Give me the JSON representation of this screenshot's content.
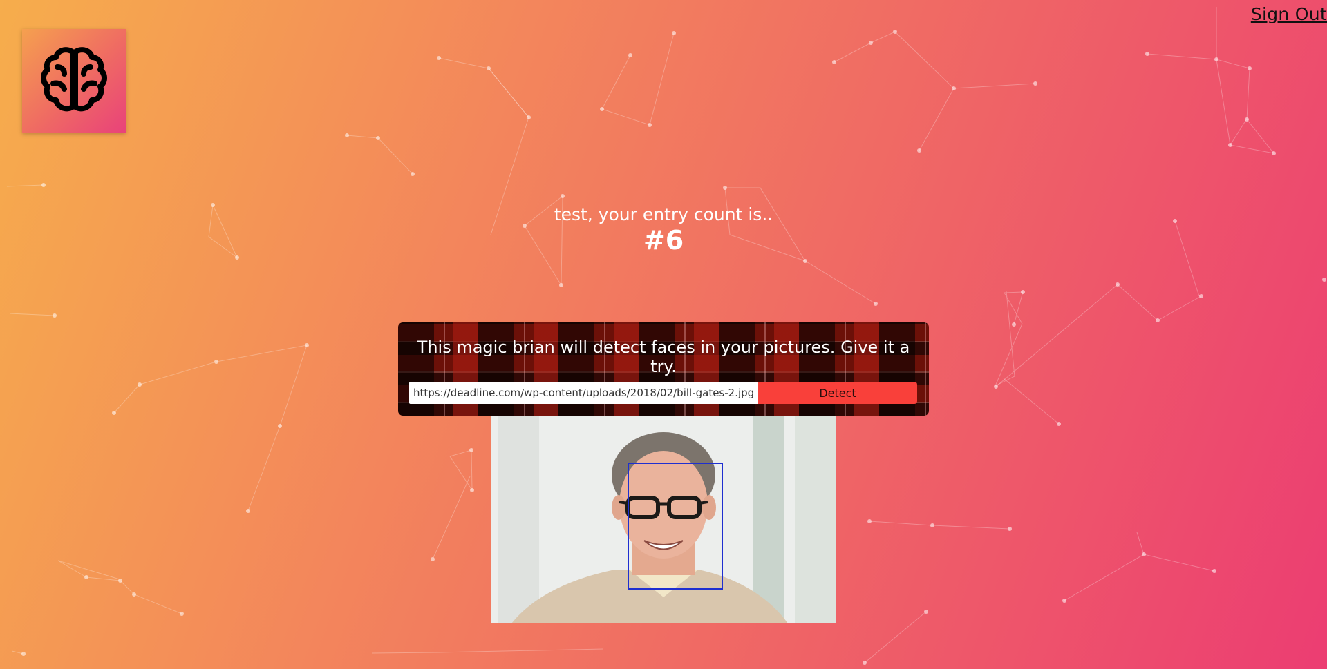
{
  "header": {
    "sign_out_label": "Sign Out",
    "logo_icon": "brain-icon"
  },
  "welcome": {
    "greeting": "test, your entry count is..",
    "count": "#6"
  },
  "detector": {
    "description": "This magic brian will detect faces in your pictures. Give it a try.",
    "url_value": "https://deadline.com/wp-content/uploads/2018/02/bill-gates-2.jpg",
    "detect_label": "Detect",
    "accent_color": "#f9403a",
    "face_box_color": "#1f2fd0"
  },
  "result": {
    "image_subject": "portrait photo",
    "faces_detected": 1
  }
}
